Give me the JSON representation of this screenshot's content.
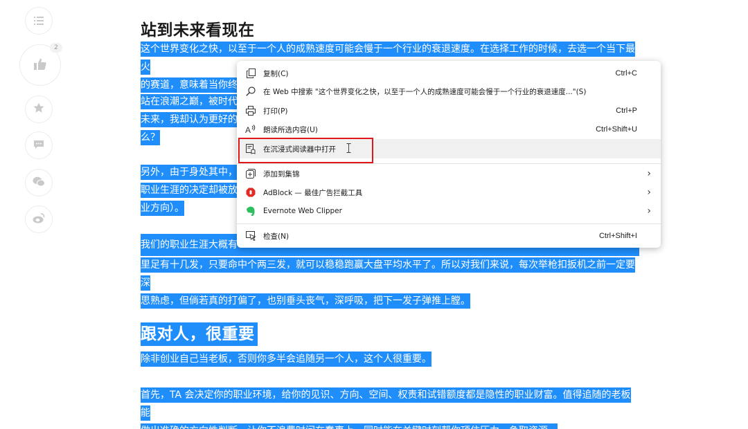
{
  "sidebar": {
    "like_count": "2"
  },
  "article": {
    "heading1": "站到未来看现在",
    "p1_line1": "这个世界变化之快，以至于一个人的成熟速度可能会慢于一个行业的衰退速度。在选择工作的时候，去选一个当下最火",
    "p1_line2": "的赛道，意味着当你终",
    "p2_line1": "站在浪潮之巅，被时代",
    "p2_line2": "未来，我却认为更好的",
    "p2_line3": "么？",
    "p3_line1": "另外，由于身处其中，",
    "p3_line2": "职业生涯的决定却被放",
    "p3_line3": "业方向）。",
    "p4_line1": "我们的职业生涯大概有",
    "p4_line2": "里足有十几发，只要命中个两三发，就可以稳稳跑赢大盘平均水平了。所以对我们来说，每次举枪扣扳机之前一定要深",
    "p4_line3": "思熟虑，但倘若真的打偏了，也别垂头丧气，深呼吸，把下一发子弹推上膛。",
    "heading2": "跟对人，很重要",
    "p5_line1": "除非创业自己当老板，否则你多半会追随另一个人，这个人很重要。",
    "p6_line1": "首先，TA 会决定你的职业环境，给你的见识、方向、空间、权责和试错额度都是隐性的职业财富。值得追随的老板能",
    "p6_line2": "做出准确的方向性判断，让你不浪费时间在蠢事上，同时能在关键时刻帮你顶住压力，争取资源。"
  },
  "context_menu": {
    "copy_label": "复制(C)",
    "copy_shortcut": "Ctrl+C",
    "search_label": "在 Web 中搜索 \"这个世界变化之快，以至于一个人的成熟速度可能会慢于一个行业的衰退速度...\"(S)",
    "print_label": "打印(P)",
    "print_shortcut": "Ctrl+P",
    "read_label": "朗读所选内容(U)",
    "read_shortcut": "Ctrl+Shift+U",
    "immersive_label": "在沉浸式阅读器中打开",
    "collection_label": "添加到集锦",
    "adblock_label": "AdBlock — 最佳广告拦截工具",
    "evernote_label": "Evernote Web Clipper",
    "inspect_label": "检查(N)",
    "inspect_shortcut": "Ctrl+Shift+I"
  },
  "colors": {
    "selection": "#1f8efa",
    "highlight_border": "#e0161a",
    "adblock_red": "#e02a25",
    "evernote_green": "#2dbe60"
  }
}
